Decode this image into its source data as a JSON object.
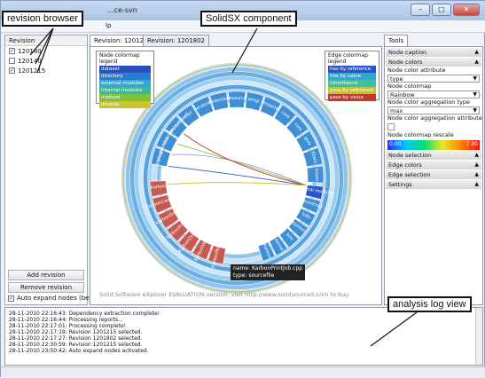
{
  "window": {
    "title": "...ce-svn",
    "menu": [
      "lp"
    ]
  },
  "callouts": {
    "revision_browser": "revision browser",
    "solidsx_component": "SolidSX component",
    "analysis_log_view": "analysis log view"
  },
  "revision_panel": {
    "header": "Revision",
    "items": [
      {
        "label": "120180",
        "checked": true
      },
      {
        "label": "120140",
        "checked": false
      },
      {
        "label": "1201215",
        "checked": true
      }
    ],
    "add_button": "Add revision",
    "remove_button": "Remove revision",
    "auto_expand_label": "Auto expand nodes (beta)",
    "auto_expand_checked": true
  },
  "tabs": [
    {
      "label": "Revision: 1201215",
      "active": true
    },
    {
      "label": "Revision: 1201802",
      "active": false
    }
  ],
  "node_legend": {
    "title": "Node colormap legend",
    "items": [
      {
        "label": "dataset",
        "color": "#2a4fbd"
      },
      {
        "label": "directory",
        "color": "#2e7bd6"
      },
      {
        "label": "external modules",
        "color": "#33a9d2"
      },
      {
        "label": "internal modules",
        "color": "#39b99c"
      },
      {
        "label": "method",
        "color": "#7cc23a"
      },
      {
        "label": "module",
        "color": "#c9c430"
      }
    ]
  },
  "edge_legend": {
    "title": "Edge colormap legend",
    "items": [
      {
        "label": "has by reference",
        "color": "#2a55c8"
      },
      {
        "label": "has by value",
        "color": "#34a6d4"
      },
      {
        "label": "inheritance",
        "color": "#3cc0a0"
      },
      {
        "label": "pass by reference",
        "color": "#c2c42e"
      },
      {
        "label": "pass by value",
        "color": "#c0392b"
      }
    ]
  },
  "radial": {
    "inner_nodes": [
      "bitmap",
      "blob",
      "socket",
      "scpl",
      "wxdesk",
      "collection",
      "resource",
      "pmgr",
      "expand",
      "core",
      "core",
      "gnfx",
      "filters",
      "lessm"
    ],
    "right_nodes": [
      "External modules",
      "soundmail",
      "kdls",
      "system",
      "bmi",
      "kernel",
      "Karbon"
    ],
    "red_nodes": [
      "KarbonNode",
      "KarbonView",
      "KarbonZoom",
      "KarbonPrint",
      "KarbonDock",
      "KarbonCanvas",
      "Karbon"
    ],
    "tooltip_name": "name: KarbonPrintJob.cpp",
    "tooltip_type": "type: sourcefile",
    "left_labels": [
      "plugins",
      "common",
      "environment"
    ]
  },
  "watermark": "Solid Software eXplorer EVALUATION version, visit http://www.solidsourceit.com to buy.",
  "tools_panel": {
    "tab": "Tools",
    "node_caption": "Node caption",
    "node_colors": "Node colors",
    "node_color_attribute_label": "Node color attribute",
    "node_color_attribute_value": "type",
    "node_colormap_label": "Node colormap",
    "node_colormap_value": "Rainbow",
    "agg_type_label": "Node color aggregation type",
    "agg_type_value": "max",
    "agg_attr_label": "Node color aggregation attribute",
    "rescale_label": "Node colormap rescale",
    "rescale_min": "0.00",
    "rescale_max": "7.00",
    "sections": [
      "Node selection",
      "Edge colors",
      "Edge selection",
      "Settings"
    ]
  },
  "log": [
    "28-11-2010 22:16:43: Dependency extraction complete!",
    "28-11-2010 22:16:44: Processing reports...",
    "28-11-2010 22:17:01: Processing complete!",
    "28-11-2010 22:17:19: Revision 1201215 selected.",
    "28-11-2010 22:17:27: Revision 1201802 selected.",
    "28-11-2010 22:30:59: Revision 1201215 selected.",
    "28-11-2010 23:50:42: Auto expand nodes activated."
  ]
}
